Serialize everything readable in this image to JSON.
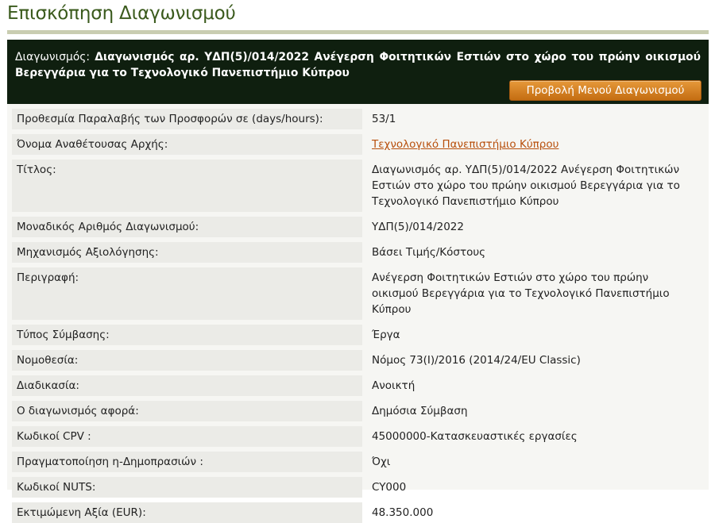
{
  "page": {
    "title": "Επισκόπηση Διαγωνισμού"
  },
  "header": {
    "prefix": "Διαγωνισμός:",
    "tender_name": "Διαγωνισμός αρ. ΥΔΠ(5)/014/2022 Ανέγερση Φοιτητικών Εστιών στο χώρο του πρώην οικισμού Βερεγγάρια για το Τεχνολογικό Πανεπιστήμιο Κύπρου",
    "menu_button_label": "Προβολή Μενού Διαγωνισμού"
  },
  "details": [
    {
      "name": "deadline",
      "label": "Προθεσμία Παραλαβής των Προσφορών σε (days/hours):",
      "value": "53/1"
    },
    {
      "name": "contracting-authority",
      "label": "Όνομα Αναθέτουσας Αρχής:",
      "value": "Τεχνολογικό Πανεπιστήμιο Κύπρου",
      "link": true
    },
    {
      "name": "title",
      "label": "Τίτλος:",
      "value": "Διαγωνισμός αρ. ΥΔΠ(5)/014/2022 Ανέγερση Φοιτητικών Εστιών στο χώρο του πρώην οικισμού Βερεγγάρια για το Τεχνολογικό Πανεπιστήμιο Κύπρου"
    },
    {
      "name": "tender-number",
      "label": "Μοναδικός Αριθμός Διαγωνισμού:",
      "value": "ΥΔΠ(5)/014/2022"
    },
    {
      "name": "evaluation",
      "label": "Μηχανισμός Αξιολόγησης:",
      "value": "Βάσει Τιμής/Κόστους"
    },
    {
      "name": "description",
      "label": "Περιγραφή:",
      "value": "Ανέγερση Φοιτητικών Εστιών στο χώρο του πρώην οικισμού Βερεγγάρια για το Τεχνολογικό Πανεπιστήμιο Κύπρου"
    },
    {
      "name": "contract-type",
      "label": "Τύπος Σύμβασης:",
      "value": "Έργα"
    },
    {
      "name": "legislation",
      "label": "Νομοθεσία:",
      "value": "Νόμος 73(Ι)/2016 (2014/24/EU Classic)"
    },
    {
      "name": "procedure",
      "label": "Διαδικασία:",
      "value": "Ανοικτή"
    },
    {
      "name": "concerns",
      "label": "Ο διαγωνισμός αφορά:",
      "value": "Δημόσια Σύμβαση"
    },
    {
      "name": "cpv-codes",
      "label": "Κωδικοί CPV :",
      "value": "45000000-Κατασκευαστικές εργασίες"
    },
    {
      "name": "e-auction",
      "label": "Πραγματοποίηση η-Δημοπρασιών :",
      "value": "Όχι"
    },
    {
      "name": "nuts-codes",
      "label": "Κωδικοί NUTS:",
      "value": "CY000"
    },
    {
      "name": "estimated-value",
      "label": "Εκτιμώμενη Αξία (EUR):",
      "value": "48.350.000"
    }
  ]
}
